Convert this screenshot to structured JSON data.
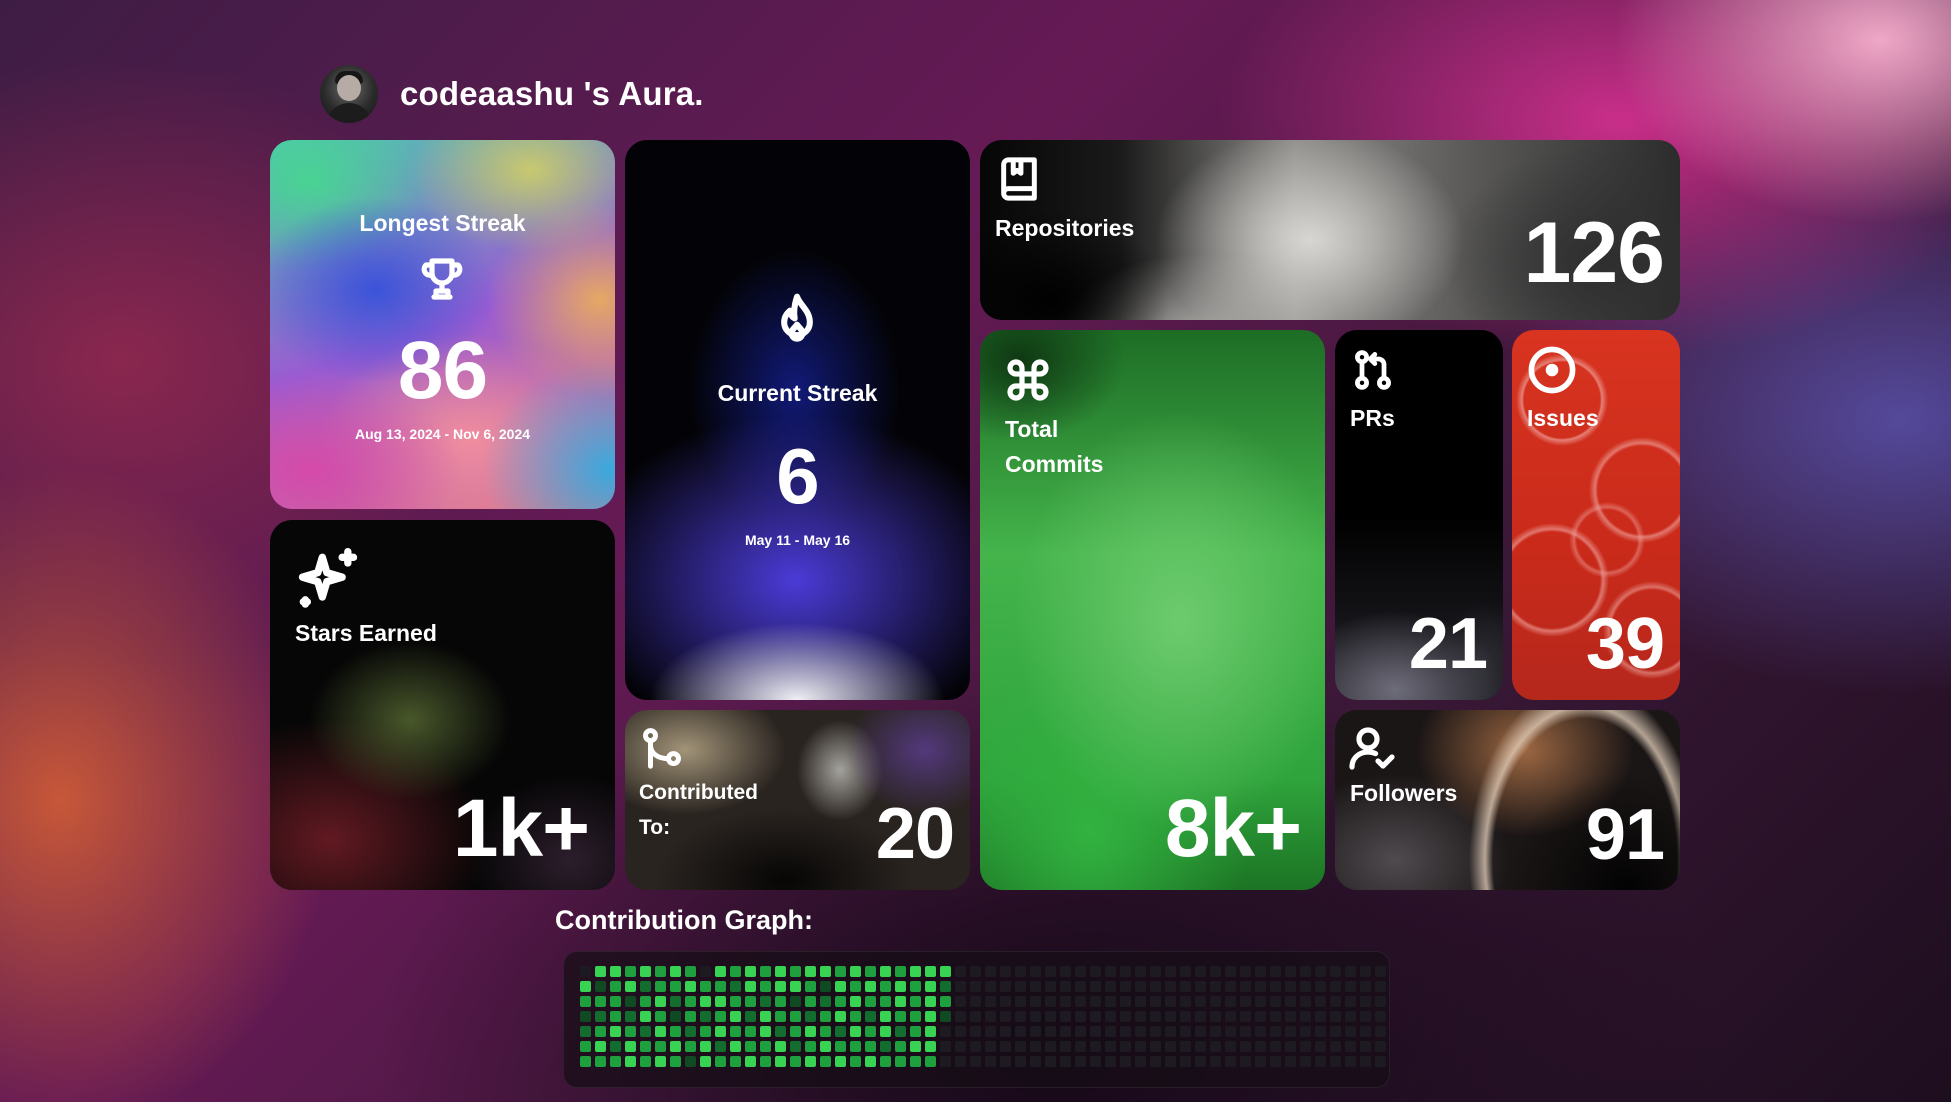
{
  "header": {
    "title": "codeaashu 's Aura."
  },
  "cards": {
    "longest_streak": {
      "label": "Longest Streak",
      "value": "86",
      "range": "Aug 13, 2024 - Nov 6, 2024"
    },
    "current_streak": {
      "label": "Current Streak",
      "value": "6",
      "range": "May 11 - May 16"
    },
    "stars": {
      "label": "Stars Earned",
      "value": "1k+"
    },
    "contributed": {
      "label_1": "Contributed",
      "label_2": "To:",
      "value": "20"
    },
    "repositories": {
      "label": "Repositories",
      "value": "126"
    },
    "commits": {
      "label_1": "Total",
      "label_2": "Commits",
      "value": "8k+"
    },
    "prs": {
      "label": "PRs",
      "value": "21"
    },
    "issues": {
      "label": "Issues",
      "value": "39"
    },
    "followers": {
      "label": "Followers",
      "value": "91"
    }
  },
  "icons": {
    "longest_streak": "trophy-icon",
    "current_streak": "flame-icon",
    "stars": "sparkles-icon",
    "contributed": "git-branch-icon",
    "repositories": "book-icon",
    "commits": "command-icon",
    "prs": "git-pull-request-icon",
    "issues": "circle-dot-icon",
    "followers": "user-check-icon"
  },
  "graph": {
    "title": "Contribution Graph:",
    "colors": [
      "#1e1a22",
      "#0f4a22",
      "#136d2e",
      "#1ea03e",
      "#39d353"
    ],
    "levels": [
      [
        0,
        4,
        3,
        1,
        2,
        3,
        3
      ],
      [
        4,
        1,
        3,
        2,
        3,
        4,
        3
      ],
      [
        4,
        3,
        3,
        3,
        4,
        2,
        3
      ],
      [
        3,
        4,
        1,
        2,
        3,
        4,
        4
      ],
      [
        4,
        2,
        3,
        4,
        2,
        3,
        3
      ],
      [
        3,
        3,
        4,
        3,
        4,
        3,
        4
      ],
      [
        4,
        3,
        2,
        1,
        3,
        4,
        3
      ],
      [
        3,
        4,
        3,
        3,
        2,
        3,
        1
      ],
      [
        0,
        3,
        4,
        2,
        3,
        4,
        4
      ],
      [
        4,
        3,
        4,
        3,
        4,
        2,
        3
      ],
      [
        3,
        2,
        3,
        4,
        3,
        4,
        3
      ],
      [
        4,
        4,
        3,
        2,
        3,
        3,
        4
      ],
      [
        3,
        3,
        2,
        4,
        4,
        3,
        3
      ],
      [
        4,
        4,
        3,
        3,
        2,
        4,
        4
      ],
      [
        3,
        4,
        1,
        3,
        3,
        2,
        3
      ],
      [
        4,
        3,
        3,
        2,
        4,
        3,
        4
      ],
      [
        4,
        1,
        2,
        3,
        3,
        4,
        3
      ],
      [
        3,
        4,
        3,
        4,
        2,
        3,
        4
      ],
      [
        4,
        3,
        4,
        3,
        4,
        3,
        3
      ],
      [
        3,
        4,
        3,
        2,
        3,
        3,
        4
      ],
      [
        4,
        3,
        3,
        4,
        4,
        2,
        3
      ],
      [
        3,
        4,
        4,
        3,
        2,
        3,
        3
      ],
      [
        4,
        3,
        3,
        3,
        3,
        4,
        3
      ],
      [
        4,
        4,
        4,
        4,
        4,
        4,
        3
      ],
      [
        4,
        2,
        3,
        1,
        0,
        0,
        0
      ],
      [
        0,
        0,
        0,
        0,
        0,
        0,
        0
      ],
      [
        0,
        0,
        0,
        0,
        0,
        0,
        0
      ],
      [
        0,
        0,
        0,
        0,
        0,
        0,
        0
      ],
      [
        0,
        0,
        0,
        0,
        0,
        0,
        0
      ],
      [
        0,
        0,
        0,
        0,
        0,
        0,
        0
      ],
      [
        0,
        0,
        0,
        0,
        0,
        0,
        0
      ],
      [
        0,
        0,
        0,
        0,
        0,
        0,
        0
      ],
      [
        0,
        0,
        0,
        0,
        0,
        0,
        0
      ],
      [
        0,
        0,
        0,
        0,
        0,
        0,
        0
      ],
      [
        0,
        0,
        0,
        0,
        0,
        0,
        0
      ],
      [
        0,
        0,
        0,
        0,
        0,
        0,
        0
      ],
      [
        0,
        0,
        0,
        0,
        0,
        0,
        0
      ],
      [
        0,
        0,
        0,
        0,
        0,
        0,
        0
      ],
      [
        0,
        0,
        0,
        0,
        0,
        0,
        0
      ],
      [
        0,
        0,
        0,
        0,
        0,
        0,
        0
      ],
      [
        0,
        0,
        0,
        0,
        0,
        0,
        0
      ],
      [
        0,
        0,
        0,
        0,
        0,
        0,
        0
      ],
      [
        0,
        0,
        0,
        0,
        0,
        0,
        0
      ],
      [
        0,
        0,
        0,
        0,
        0,
        0,
        0
      ],
      [
        0,
        0,
        0,
        0,
        0,
        0,
        0
      ],
      [
        0,
        0,
        0,
        0,
        0,
        0,
        0
      ],
      [
        0,
        0,
        0,
        0,
        0,
        0,
        0
      ],
      [
        0,
        0,
        0,
        0,
        0,
        0,
        0
      ],
      [
        0,
        0,
        0,
        0,
        0,
        0,
        0
      ],
      [
        0,
        0,
        0,
        0,
        0,
        0,
        0
      ],
      [
        0,
        0,
        0,
        0,
        0,
        0,
        0
      ],
      [
        0,
        0,
        0,
        0,
        0,
        0,
        0
      ],
      [
        0,
        0,
        0,
        0,
        0,
        0,
        0
      ],
      [
        0,
        0,
        0,
        0,
        0,
        0,
        0
      ]
    ]
  }
}
